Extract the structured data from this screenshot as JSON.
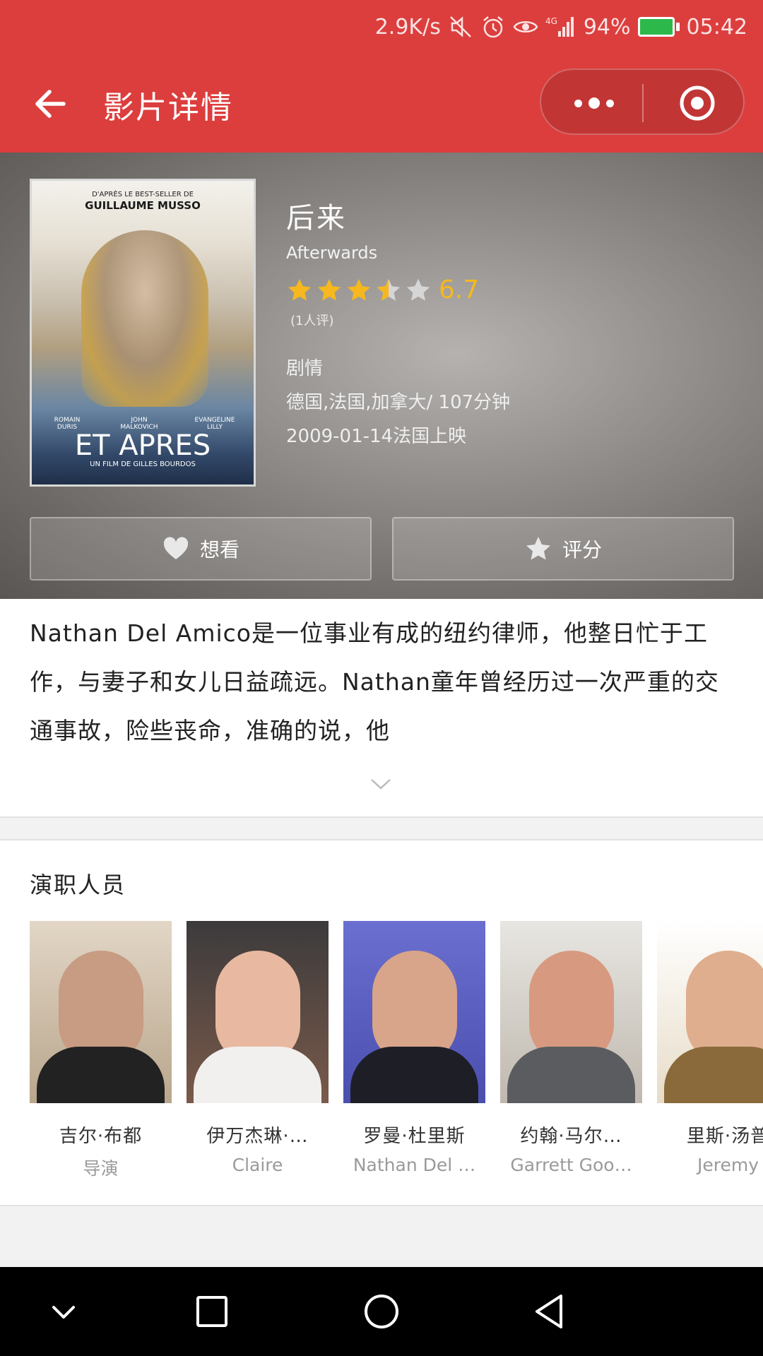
{
  "status_bar": {
    "net_speed": "2.9K/s",
    "signal": "4G",
    "battery": "94%",
    "time": "05:42",
    "icons": [
      "mute-icon",
      "alarm-icon",
      "eye-icon",
      "signal-icon",
      "battery-icon"
    ]
  },
  "title_bar": {
    "title": "影片详情",
    "back_icon": "arrow-left-icon",
    "more_icon": "more-dots-icon",
    "close_icon": "target-circle-icon"
  },
  "movie": {
    "title": "后来",
    "original_title": "Afterwards",
    "rating": 6.7,
    "rating_text": "6.7",
    "stars": 3.5,
    "star_color": "#f6b81e",
    "votes": "(1人评)",
    "genre": "剧情",
    "region_duration": "德国,法国,加拿大/ 107分钟",
    "release": "2009-01-14法国上映",
    "poster": {
      "top_line": "D'APRÈS LE BEST-SELLER DE",
      "author": "GUILLAUME MUSSO",
      "cast": [
        "ROMAIN DURIS",
        "JOHN MALKOVICH",
        "EVANGELINE LILLY"
      ],
      "title": "ET APRES",
      "subtitle": "UN FILM DE GILLES BOURDOS"
    }
  },
  "actions": {
    "want": "想看",
    "rate": "评分"
  },
  "synopsis": "Nathan Del Amico是一位事业有成的纽约律师，他整日忙于工作，与妻子和女儿日益疏远。Nathan童年曾经历过一次严重的交通事故，险些丧命，准确的说，他",
  "cast": {
    "title": "演职人员",
    "people": [
      {
        "name": "吉尔·布都",
        "role": "导演"
      },
      {
        "name": "伊万杰琳·…",
        "role": "Claire"
      },
      {
        "name": "罗曼·杜里斯",
        "role": "Nathan Del …"
      },
      {
        "name": "约翰·马尔…",
        "role": "Garrett Goo…"
      },
      {
        "name": "里斯·汤普",
        "role": "Jeremy"
      }
    ]
  },
  "colors": {
    "brand": "#dc3e3d",
    "rating": "#f6b81e"
  }
}
